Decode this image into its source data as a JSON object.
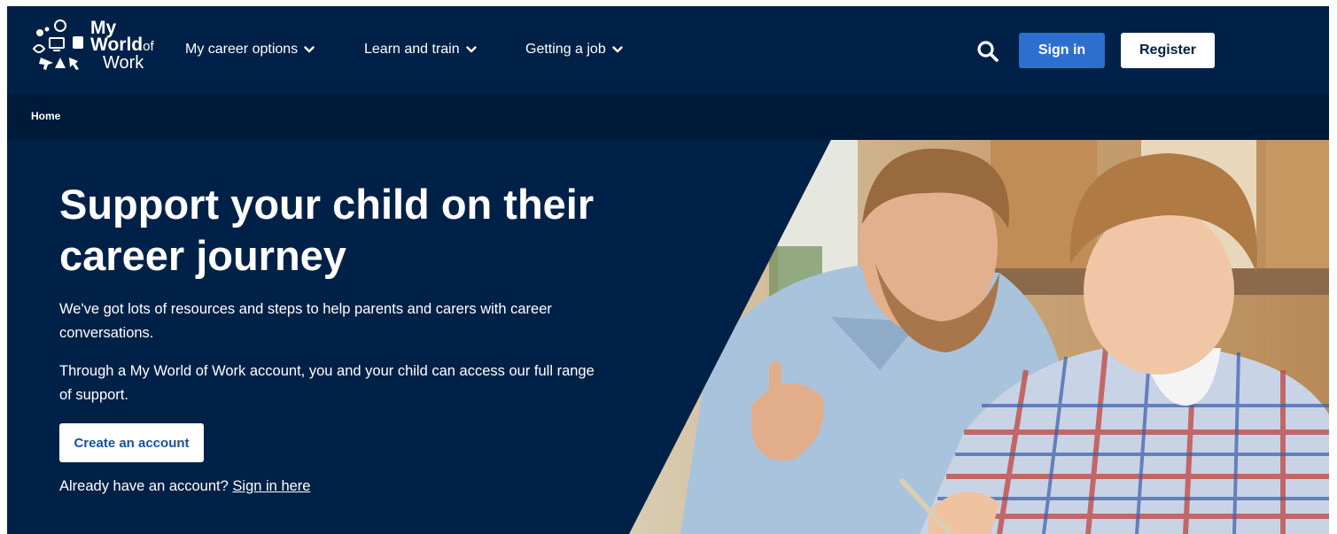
{
  "header": {
    "logo": {
      "line1": "My",
      "line2": "World",
      "line2_suffix": "of",
      "line3": "Work"
    },
    "nav": [
      {
        "label": "My career options"
      },
      {
        "label": "Learn and train"
      },
      {
        "label": "Getting a job"
      }
    ],
    "sign_in_label": "Sign in",
    "register_label": "Register"
  },
  "breadcrumb": {
    "home": "Home"
  },
  "hero": {
    "title": "Support your child on their career journey",
    "para1": "We've got lots of resources and steps to help parents and carers with career conversations.",
    "para2": "Through a My World of Work account, you and your child can access our full range of support.",
    "cta_label": "Create an account",
    "signin_prompt": "Already have an account?",
    "signin_link": "Sign in here"
  },
  "colors": {
    "navy": "#002147",
    "breadcrumb_bar": "#001a3a",
    "sign_in_blue": "#2d6fce",
    "white": "#ffffff"
  },
  "icons": [
    "search-icon",
    "chevron-down-icon"
  ]
}
